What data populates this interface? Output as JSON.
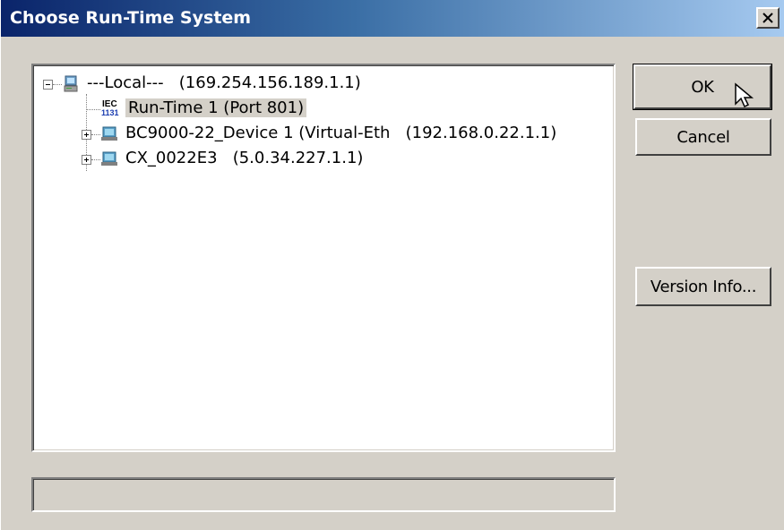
{
  "window": {
    "title": "Choose Run-Time System",
    "close_glyph": "X"
  },
  "tree": {
    "root": {
      "label": "---Local---   (169.254.156.189.1.1)",
      "icon": "computer-icon",
      "expanded": true
    },
    "children": [
      {
        "label": "Run-Time 1 (Port 801)",
        "icon": "iec-1131-icon",
        "selected": true
      },
      {
        "label": "BC9000-22_Device 1 (Virtual-Eth   (192.168.0.22.1.1)",
        "icon": "network-device-icon",
        "expanded": false
      },
      {
        "label": "CX_0022E3   (5.0.34.227.1.1)",
        "icon": "network-device-icon",
        "expanded": false
      }
    ],
    "iec_icon_text": {
      "top": "IEC",
      "bottom": "1131"
    }
  },
  "buttons": {
    "ok": "OK",
    "cancel": "Cancel",
    "version_info": "Version Info..."
  },
  "status": {
    "text": ""
  },
  "colors": {
    "title_start": "#0a246a",
    "title_end": "#a6caf0",
    "face": "#d4d0c8"
  }
}
